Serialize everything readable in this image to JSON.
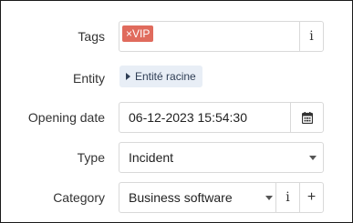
{
  "fields": {
    "tags": {
      "label": "Tags",
      "chip": "×VIP",
      "info_icon": "info-icon"
    },
    "entity": {
      "label": "Entity",
      "value": "Entité racine",
      "icon": "caret-right-icon"
    },
    "opening_date": {
      "label": "Opening date",
      "value": "06-12-2023 15:54:30",
      "icon": "calendar-icon"
    },
    "type": {
      "label": "Type",
      "value": "Incident",
      "icon": "chevron-down-icon"
    },
    "category": {
      "label": "Category",
      "value": "Business software",
      "info_label": "i",
      "add_label": "+",
      "icon": "chevron-down-icon"
    }
  },
  "colors": {
    "tag_bg": "#e06b5d",
    "entity_bg": "#e8eef6",
    "border": "#d9d9d9"
  }
}
